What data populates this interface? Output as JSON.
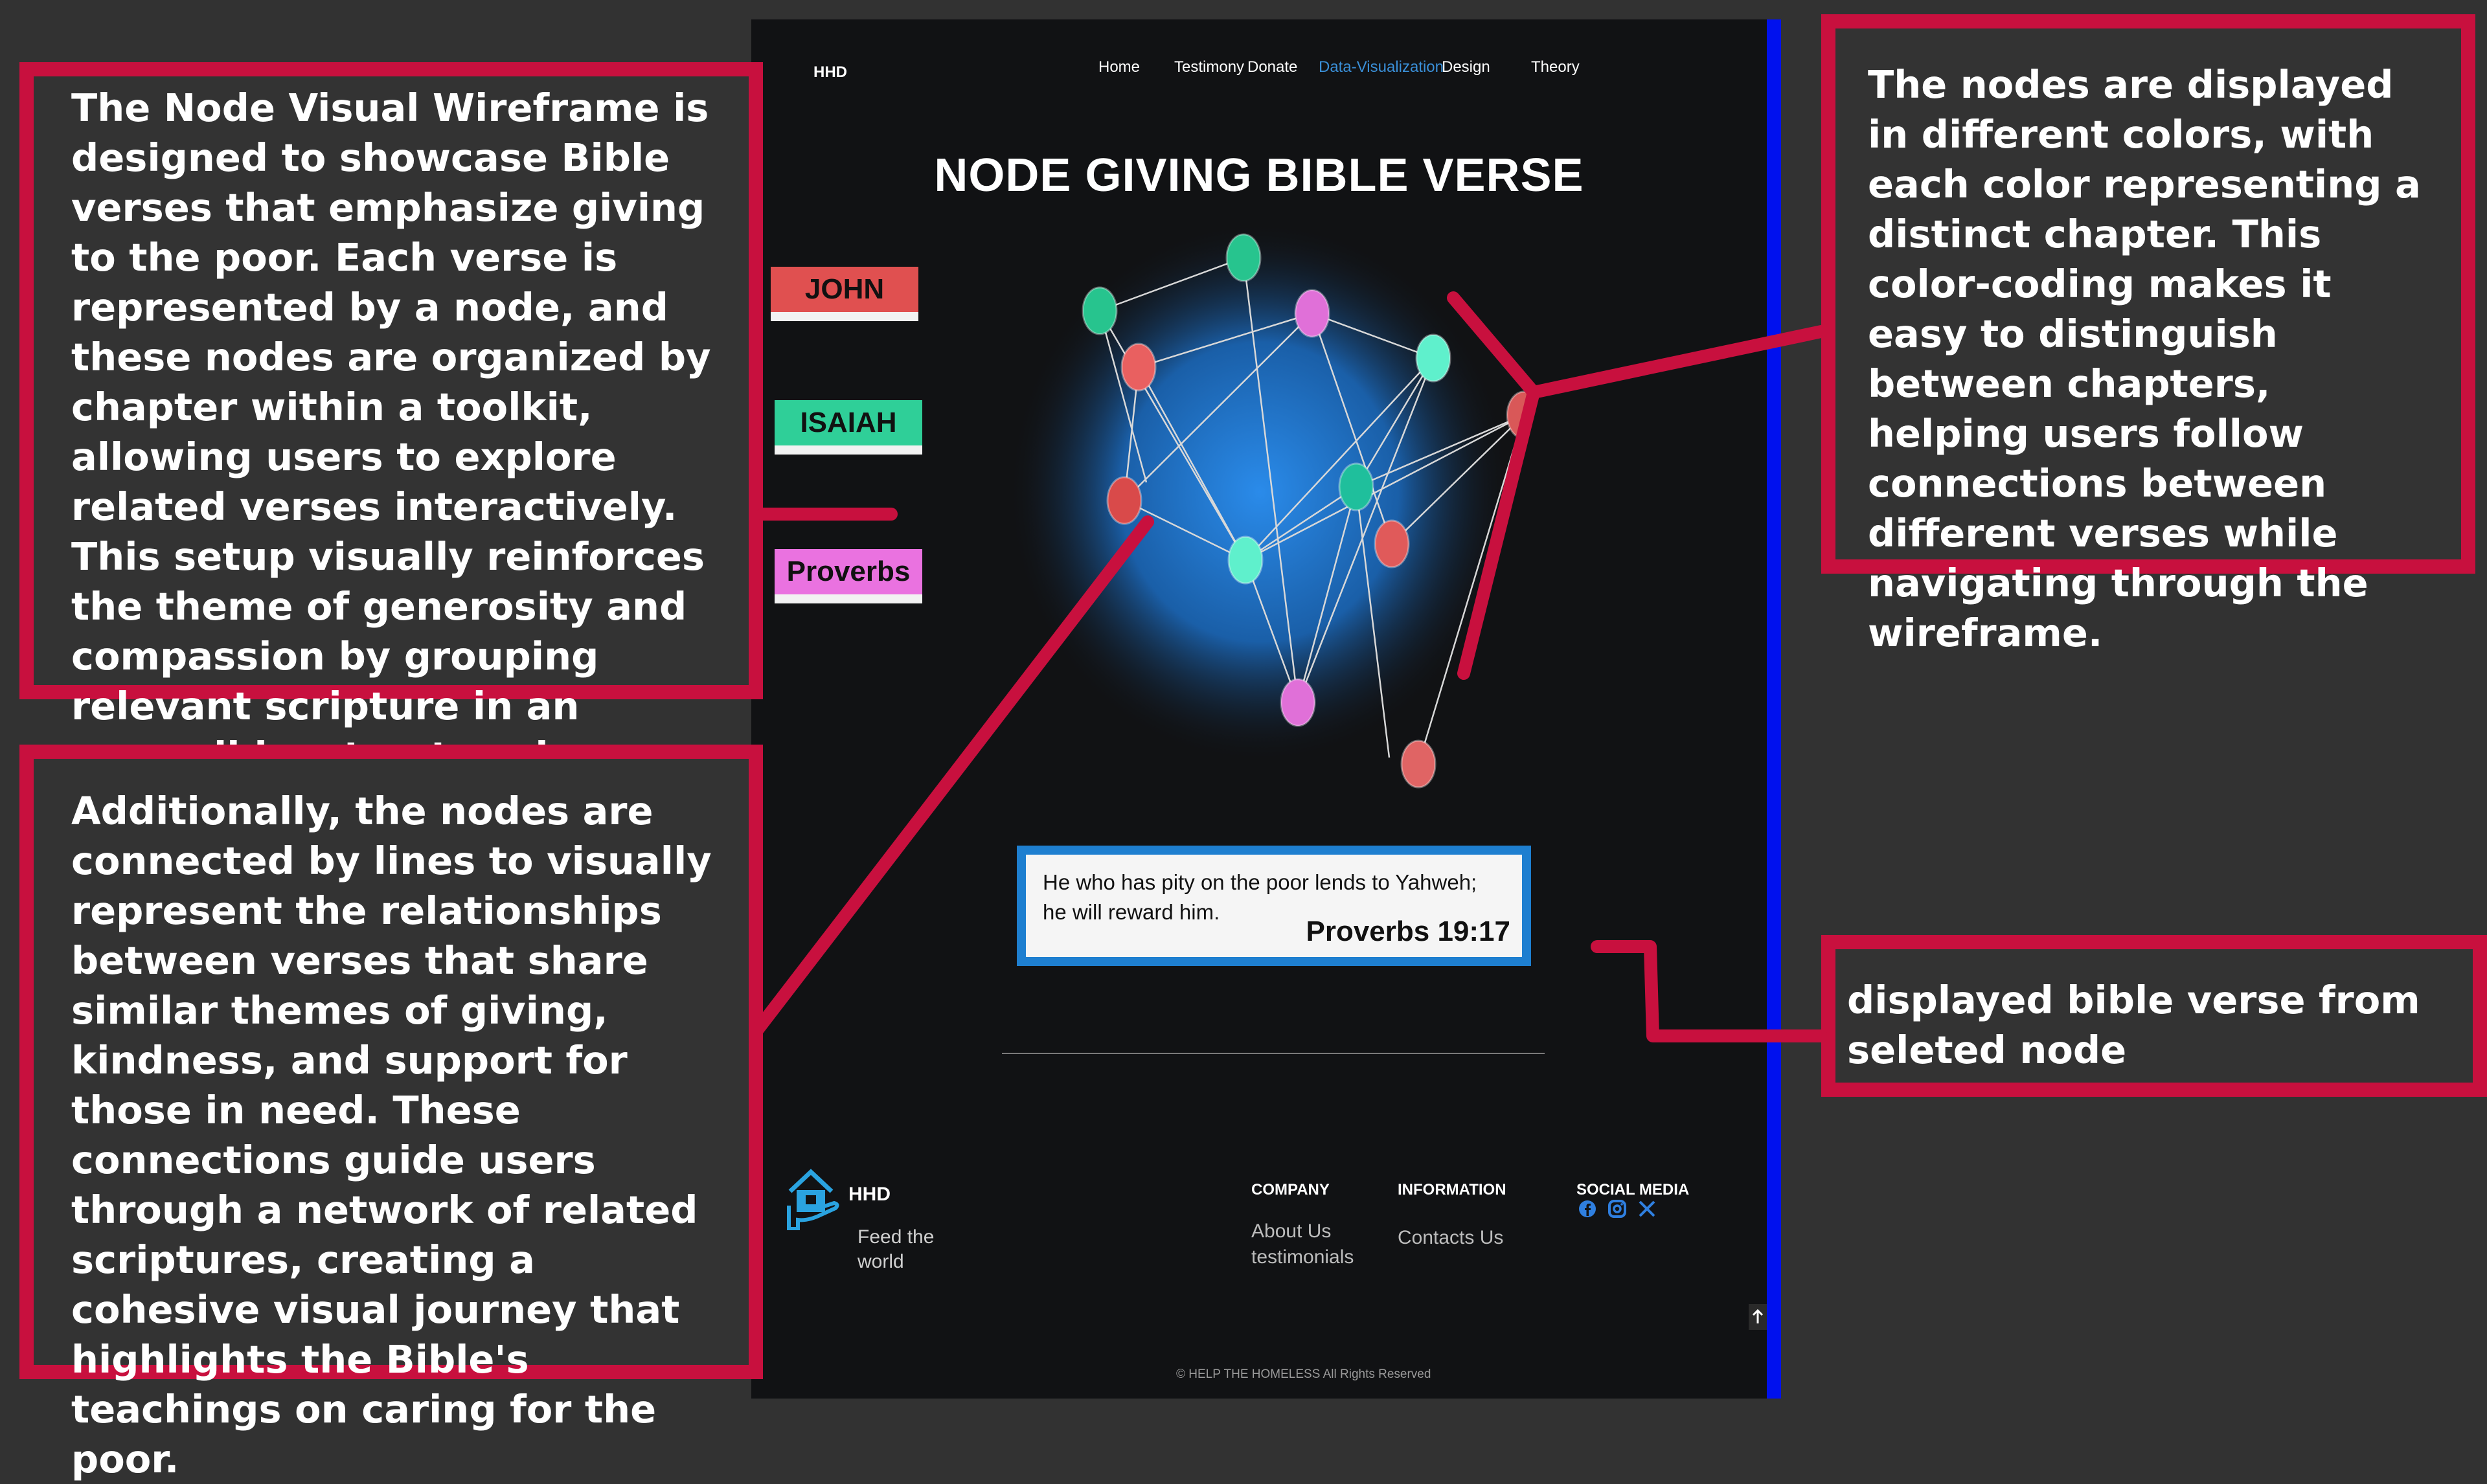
{
  "annotations": {
    "left_top": "The Node Visual Wireframe is designed to showcase Bible verses that emphasize giving to the poor. Each verse is represented by a node, and these nodes are organized by chapter within a toolkit, allowing users to explore related verses interactively. This setup visually reinforces the theme of generosity and compassion by grouping relevant scripture in an accessible, structured format.",
    "left_bottom": "Additionally, the nodes are connected by lines to visually represent the relationships between verses that share similar themes of giving, kindness, and support for those in need. These connections guide users through a network of related scriptures, creating a cohesive visual journey that highlights the Bible's teachings on caring for the poor.",
    "right_top": "The nodes are displayed in different colors, with each color representing a distinct chapter. This color-coding makes it easy to distinguish between chapters, helping users follow connections between different verses while navigating through the wireframe.",
    "right_bottom": "displayed bible verse from seleted node"
  },
  "site": {
    "logo": "HHD",
    "nav": [
      "Home",
      "Testimony",
      "Donate",
      "Data-Visualization",
      "Design",
      "Theory"
    ],
    "active_nav": "Data-Visualization",
    "title": "NODE GIVING BIBLE VERSE",
    "chapters": [
      {
        "label": "JOHN",
        "color": "#e05050"
      },
      {
        "label": "ISAIAH",
        "color": "#2fcf98"
      },
      {
        "label": "Proverbs",
        "color": "#ea72e0"
      }
    ],
    "verse": {
      "text": "He who has pity on the poor lends to Yahweh; he will reward him.",
      "reference": "Proverbs 19:17"
    },
    "footer": {
      "brand": "HHD",
      "tagline": "Feed the world",
      "company_heading": "COMPANY",
      "company_links": [
        "About Us",
        "testimonials"
      ],
      "information_heading": "INFORMATION",
      "information_links": [
        "Contacts Us"
      ],
      "social_heading": "SOCIAL MEDIA",
      "social_icons": [
        "facebook-icon",
        "instagram-icon",
        "x-icon"
      ],
      "copyright": "HELP THE HOMELESS All Rights Reserved"
    }
  },
  "colors": {
    "annotation_border": "#c8103e",
    "accent_blue": "#1e7fd0",
    "john": "#e05050",
    "isaiah": "#2fcf98",
    "proverbs": "#ea72e0"
  }
}
